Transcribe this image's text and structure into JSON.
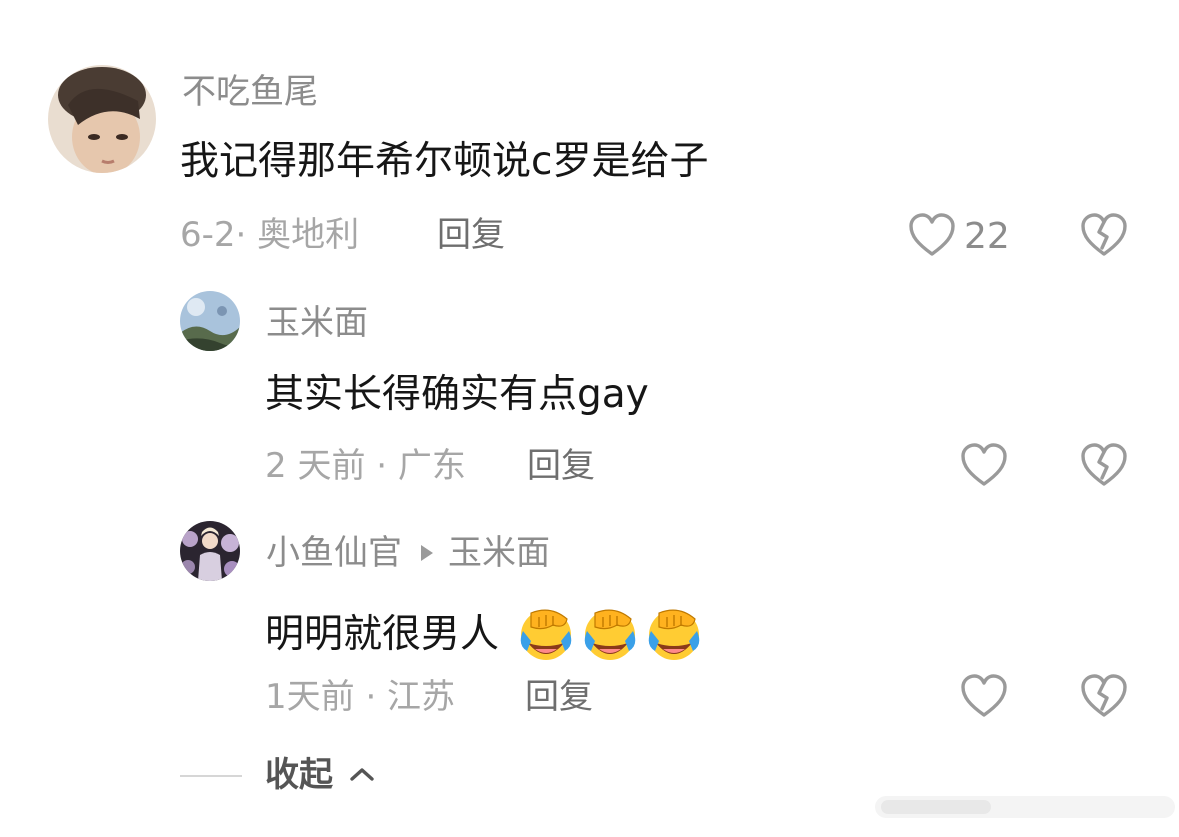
{
  "comments": [
    {
      "user": "不吃鱼尾",
      "text": "我记得那年希尔顿说c罗是给子",
      "meta": "6-2· 奥地利",
      "reply_label": "回复",
      "likes": "22"
    },
    {
      "user": "玉米面",
      "text": "其实长得确实有点gay",
      "meta": "2 天前 · 广东",
      "reply_label": "回复"
    },
    {
      "user": "小鱼仙官",
      "reply_to": "玉米面",
      "text": "明明就很男人",
      "emojis": [
        "facepalm-laugh-emoji",
        "facepalm-laugh-emoji",
        "facepalm-laugh-emoji"
      ],
      "meta": "1天前 · 江苏",
      "reply_label": "回复"
    }
  ],
  "collapse_label": "收起",
  "icons": {
    "like": "heart-outline-icon",
    "dislike": "broken-heart-icon",
    "reply_arrow": "triangle-right-icon",
    "collapse": "chevron-up-icon"
  },
  "colors": {
    "text": "#161616",
    "name": "#8c8c8c",
    "meta": "#a6a6a6",
    "icon": "#9a9a9a"
  }
}
